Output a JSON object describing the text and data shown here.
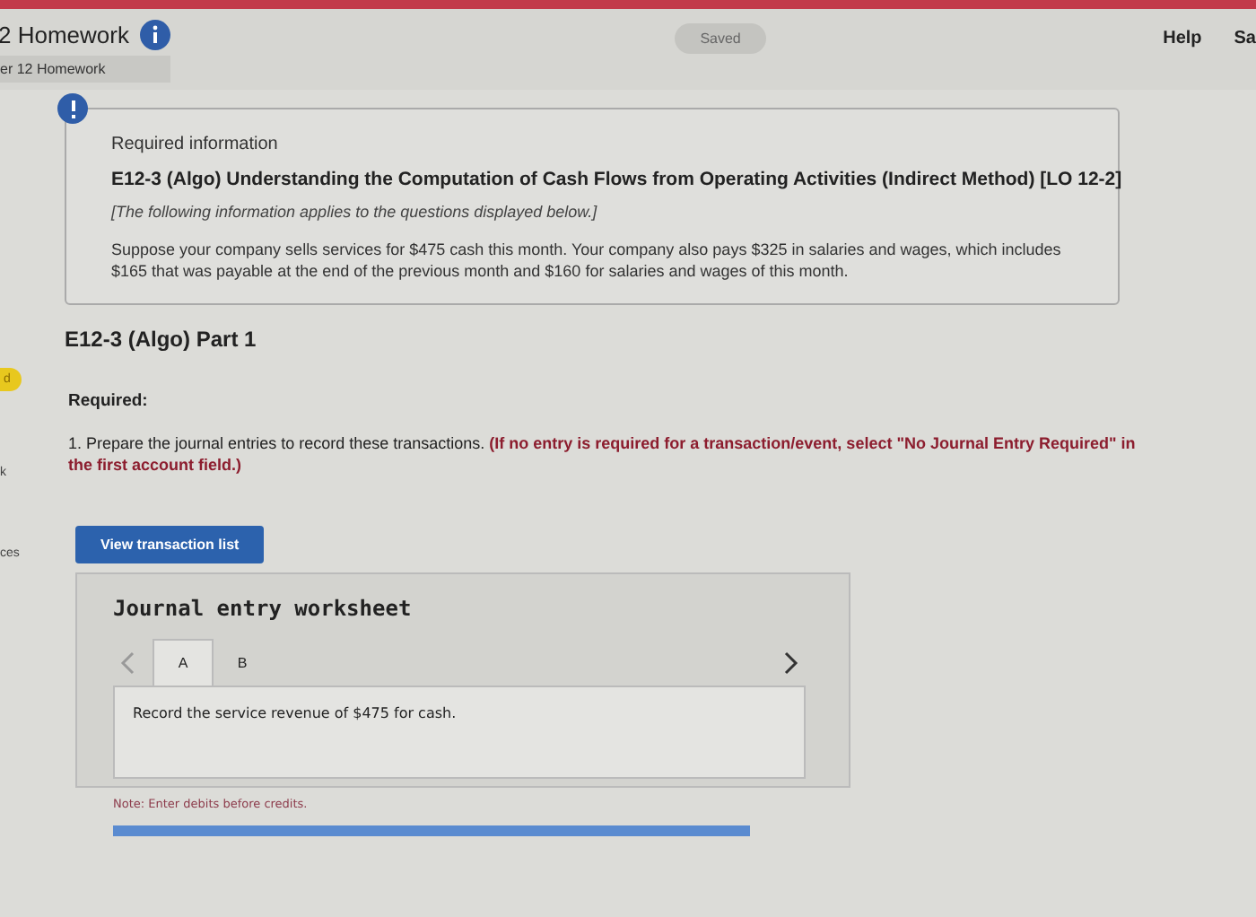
{
  "header": {
    "title": "2 Homework",
    "subtitle": "er 12 Homework",
    "status": "Saved",
    "links": [
      "Help",
      "Sa"
    ]
  },
  "sidebar": {
    "items": [
      {
        "label": "d",
        "kind": "badge"
      },
      {
        "label": "k",
        "kind": "text"
      },
      {
        "label": "ces",
        "kind": "text"
      }
    ]
  },
  "info_card": {
    "heading": "Required information",
    "title": "E12-3 (Algo) Understanding the Computation of Cash Flows from Operating Activities (Indirect Method) [LO 12-2]",
    "note": "[The following information applies to the questions displayed below.]",
    "body": "Suppose your company sells services for $475 cash this month. Your company also pays $325 in salaries and wages, which includes $165 that was payable at the end of the previous month and $160 for salaries and wages of this month."
  },
  "part": {
    "title": "E12-3 (Algo) Part 1",
    "required_label": "Required:",
    "instruction": "1. Prepare the journal entries to record these transactions. **(If no entry is required for a transaction/event, select \"No Journal Entry Required\" in the first account field.)**",
    "button": "View transaction list"
  },
  "worksheet": {
    "title": "Journal entry worksheet",
    "tabs": [
      {
        "label": "A",
        "selected": true
      },
      {
        "label": "B",
        "selected": false
      }
    ],
    "prompt": "Record the service revenue of $475 for cash.",
    "note": "Note: Enter debits before credits."
  }
}
